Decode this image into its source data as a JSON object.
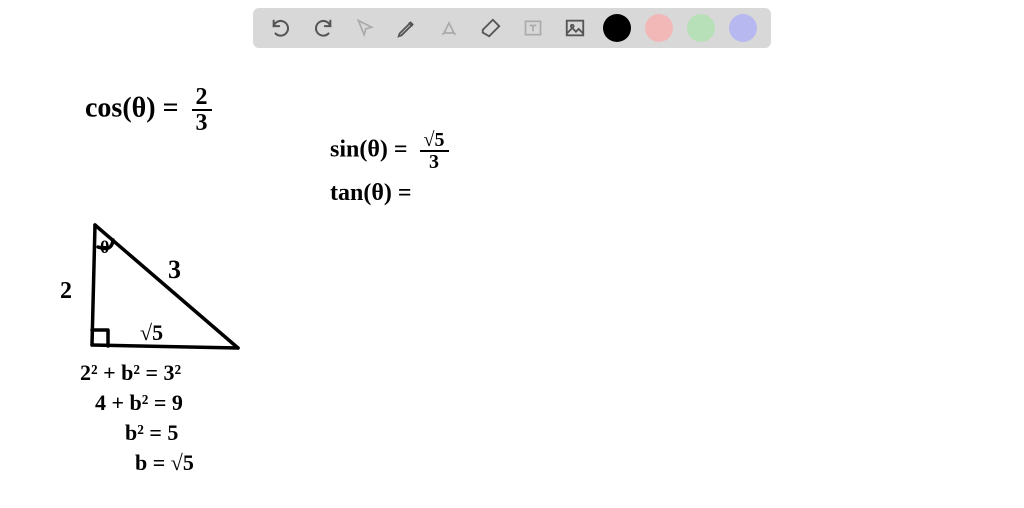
{
  "toolbar": {
    "undo": "undo",
    "redo": "redo",
    "select": "select",
    "pen": "pen",
    "tools": "tools",
    "eraser": "eraser",
    "text": "text",
    "image": "image",
    "colors": {
      "black": "#000000",
      "pink": "#f2b8b8",
      "green": "#b8e0b8",
      "lavender": "#b8b8f0"
    }
  },
  "math": {
    "cos_lhs": "cos(θ) =",
    "cos_num": "2",
    "cos_den": "3",
    "sin_lhs": "sin(θ) =",
    "sin_num": "√5",
    "sin_den": "3",
    "tan_lhs": "tan(θ) =",
    "tan_rhs": "",
    "triangle": {
      "side_left": "2",
      "hypotenuse": "3",
      "base": "√5",
      "angle": "θ"
    },
    "work": {
      "line1": "2² + b² = 3²",
      "line2": "4 + b² = 9",
      "line3": "b² = 5",
      "line4": "b = √5"
    }
  }
}
